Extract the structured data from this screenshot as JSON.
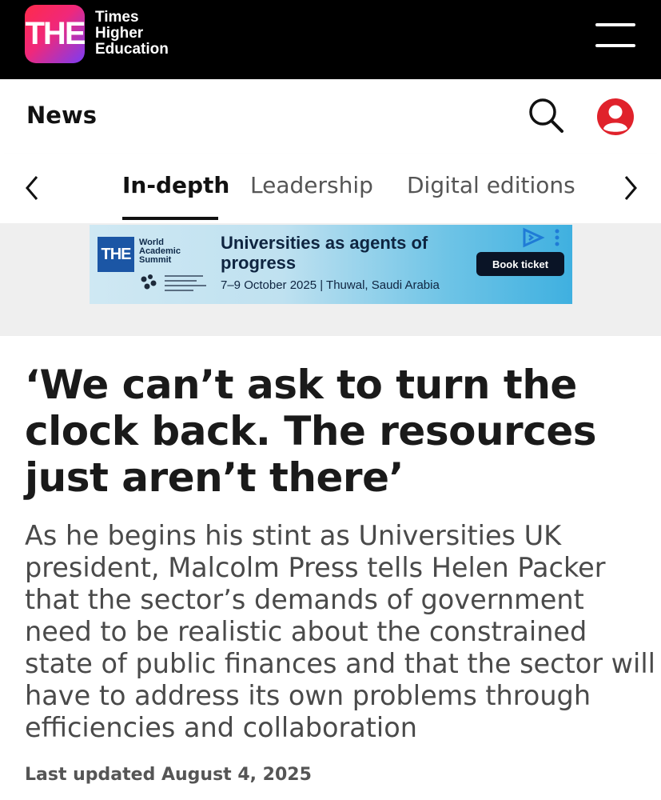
{
  "header": {
    "logo_mark": "THE",
    "logo_line1": "Times",
    "logo_line2": "Higher",
    "logo_line3": "Education",
    "menu_icon": "hamburger-menu-icon"
  },
  "section": {
    "title": "News",
    "search_icon": "search-icon",
    "account_icon": "user-account-icon",
    "account_color": "#e0222b"
  },
  "tabs": {
    "items": [
      {
        "label": "In-depth",
        "active": true
      },
      {
        "label": "Leadership",
        "active": false
      },
      {
        "label": "Digital editions",
        "active": false
      }
    ],
    "prev_icon": "chevron-left-icon",
    "next_icon": "chevron-right-icon"
  },
  "ad": {
    "logo_mark": "THE",
    "event_name_line1": "World",
    "event_name_line2": "Academic",
    "event_name_line3": "Summit",
    "heading": "Universities as agents of progress",
    "date_location": "7–9 October 2025 | Thuwal, Saudi Arabia",
    "cta": "Book ticket",
    "choices_icon": "ad-choices-icon"
  },
  "article": {
    "headline": "‘We can’t ask to turn the clock back. The resources just aren’t there’",
    "standfirst": "As he begins his stint as Universities UK president, Malcolm Press tells Helen Packer that the sector’s demands of government need to be realistic about the constrained state of public finances and that the sector will have to address its own problems through efficiencies and collaboration",
    "last_updated": "Last updated August 4, 2025"
  }
}
